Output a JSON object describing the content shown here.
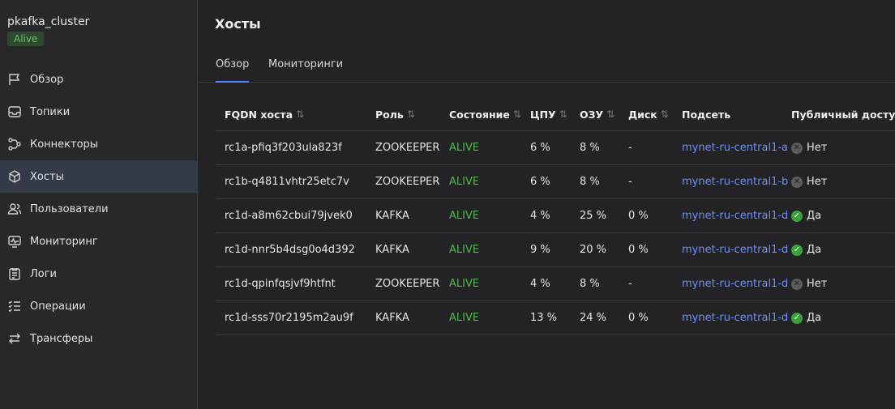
{
  "cluster": {
    "name": "pkafka_cluster",
    "status": "Alive"
  },
  "sidebar": {
    "items": [
      {
        "label": "Обзор",
        "icon": "flag-icon"
      },
      {
        "label": "Топики",
        "icon": "inbox-icon"
      },
      {
        "label": "Коннекторы",
        "icon": "connector-icon"
      },
      {
        "label": "Хосты",
        "icon": "cube-icon"
      },
      {
        "label": "Пользователи",
        "icon": "users-icon"
      },
      {
        "label": "Мониторинг",
        "icon": "monitor-icon"
      },
      {
        "label": "Логи",
        "icon": "logs-icon"
      },
      {
        "label": "Операции",
        "icon": "operations-icon"
      },
      {
        "label": "Трансферы",
        "icon": "transfer-icon"
      }
    ],
    "active_index": 3
  },
  "page": {
    "title": "Хосты"
  },
  "tabs": [
    {
      "label": "Обзор",
      "active": true
    },
    {
      "label": "Мониторинги",
      "active": false
    }
  ],
  "table": {
    "columns": [
      "FQDN хоста",
      "Роль",
      "Состояние",
      "ЦПУ",
      "ОЗУ",
      "Диск",
      "Подсеть",
      "Публичный доступ"
    ],
    "rows": [
      {
        "fqdn": "rc1a-pfiq3f203ula823f",
        "role": "ZOOKEEPER",
        "state": "ALIVE",
        "cpu": "6 %",
        "ram": "8 %",
        "disk": "-",
        "subnet": "mynet-ru-central1-a",
        "public": "Нет",
        "public_yes": false
      },
      {
        "fqdn": "rc1b-q4811vhtr25etc7v",
        "role": "ZOOKEEPER",
        "state": "ALIVE",
        "cpu": "6 %",
        "ram": "8 %",
        "disk": "-",
        "subnet": "mynet-ru-central1-b",
        "public": "Нет",
        "public_yes": false
      },
      {
        "fqdn": "rc1d-a8m62cbui79jvek0",
        "role": "KAFKA",
        "state": "ALIVE",
        "cpu": "4 %",
        "ram": "25 %",
        "disk": "0 %",
        "subnet": "mynet-ru-central1-d",
        "public": "Да",
        "public_yes": true
      },
      {
        "fqdn": "rc1d-nnr5b4dsg0o4d392",
        "role": "KAFKA",
        "state": "ALIVE",
        "cpu": "9 %",
        "ram": "20 %",
        "disk": "0 %",
        "subnet": "mynet-ru-central1-d",
        "public": "Да",
        "public_yes": true
      },
      {
        "fqdn": "rc1d-qpinfqsjvf9htfnt",
        "role": "ZOOKEEPER",
        "state": "ALIVE",
        "cpu": "4 %",
        "ram": "8 %",
        "disk": "-",
        "subnet": "mynet-ru-central1-d",
        "public": "Нет",
        "public_yes": false
      },
      {
        "fqdn": "rc1d-sss70r2195m2au9f",
        "role": "KAFKA",
        "state": "ALIVE",
        "cpu": "13 %",
        "ram": "24 %",
        "disk": "0 %",
        "subnet": "mynet-ru-central1-d",
        "public": "Да",
        "public_yes": true
      }
    ]
  },
  "colors": {
    "accent": "#5282ff",
    "alive": "#4fb84f",
    "link": "#6b8eff",
    "yes": "#3aa23a",
    "no": "#5c5c5c"
  }
}
